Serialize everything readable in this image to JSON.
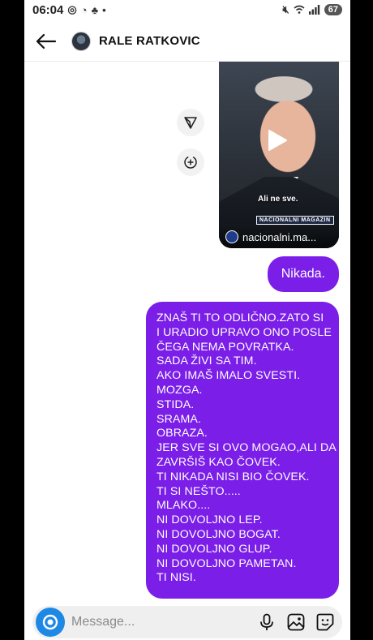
{
  "status_bar": {
    "time": "06:04",
    "left_icons": [
      "whatsapp-icon",
      "chat-icon",
      "snapchat-icon",
      "dot-icon"
    ],
    "right_icons": [
      "mute-icon",
      "wifi-icon",
      "signal-icon"
    ],
    "battery": "67"
  },
  "header": {
    "contact_name": "RALE RATKOVIC"
  },
  "video_post": {
    "caption": "Ali ne sve.",
    "badge": "NACIONALNI MAGAZIN",
    "source": "nacionalni.ma..."
  },
  "messages": {
    "short": "Nikada.",
    "long_lines": [
      "ZNAŠ TI TO ODLIČNO.ZATO SI",
      "I URADIO UPRAVO ONO POSLE",
      "ČEGA NEMA POVRATKA.",
      "SADA ŽIVI SA TIM.",
      "AKO IMAŠ IMALO SVESTI.",
      "MOZGA.",
      "STIDA.",
      "SRAMA.",
      "OBRAZA.",
      "JER SVE SI OVO MOGAO,ALI DA",
      "ZAVRŠIŠ KAO ČOVEK.",
      "TI NIKADA NISI BIO ČOVEK.",
      "TI SI NEŠTO.....",
      "MLAKO....",
      "NI DOVOLJNO LEP.",
      "NI DOVOLJNO BOGAT.",
      "NI DOVOLJNO GLUP.",
      "NI DOVOLJNO PAMETAN.",
      "TI NISI."
    ]
  },
  "composer": {
    "placeholder": "Message..."
  },
  "colors": {
    "bubble": "#7a1ee8",
    "camera_button": "#1e88e5"
  }
}
